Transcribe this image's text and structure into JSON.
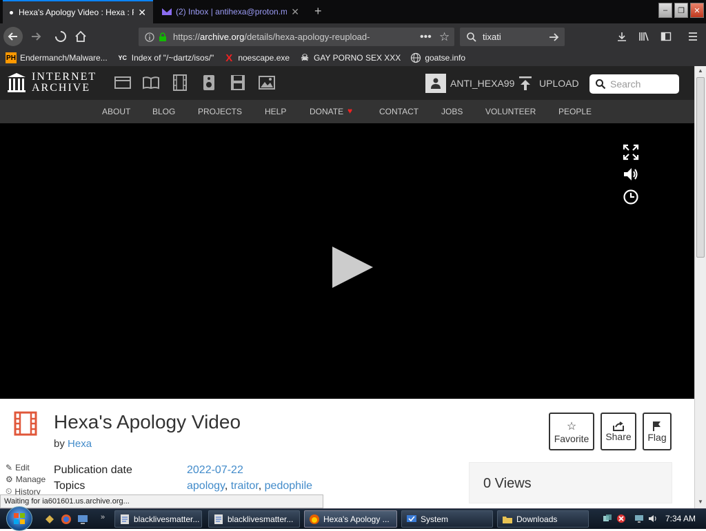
{
  "browser": {
    "tabs": [
      {
        "title": "Hexa's Apology Video : Hexa : F",
        "active": true
      },
      {
        "title": "(2) Inbox | antihexa@proton.m",
        "active": false
      }
    ],
    "url": {
      "scheme": "https://",
      "domain": "archive.org",
      "path": "/details/hexa-apology-reupload-"
    },
    "search_value": "tixati",
    "bookmarks": [
      {
        "label": "Endermanch/Malware...",
        "icon": "pornhub-icon"
      },
      {
        "label": "Index of \"/~dartz/isos/\"",
        "icon": "yc-icon"
      },
      {
        "label": "noescape.exe",
        "icon": "x-icon"
      },
      {
        "label": "GAY PORNO SEX XXX",
        "icon": "skull-icon"
      },
      {
        "label": "goatse.info",
        "icon": "globe-icon"
      }
    ],
    "status_text": "Waiting for ia601601.us.archive.org..."
  },
  "ia": {
    "logo": {
      "line1": "INTERNET",
      "line2": "ARCHIVE"
    },
    "user": "ANTI_HEXA99",
    "upload": "UPLOAD",
    "search_placeholder": "Search",
    "nav": [
      "ABOUT",
      "BLOG",
      "PROJECTS",
      "HELP",
      "DONATE",
      "CONTACT",
      "JOBS",
      "VOLUNTEER",
      "PEOPLE"
    ]
  },
  "item": {
    "title": "Hexa's Apology Video",
    "by_prefix": "by",
    "author": "Hexa",
    "actions": {
      "favorite": "Favorite",
      "share": "Share",
      "flag": "Flag"
    },
    "side_links": {
      "edit": "Edit",
      "manage": "Manage",
      "history": "History"
    },
    "meta": {
      "pub_label": "Publication date",
      "pub_value": "2022-07-22",
      "topics_label": "Topics",
      "topics": [
        "apology",
        "traitor",
        "pedophile"
      ]
    },
    "views": "0 Views"
  },
  "taskbar": {
    "items": [
      "blacklivesmatter...",
      "blacklivesmatter...",
      "Hexa's Apology ...",
      "System",
      "Downloads"
    ],
    "active_index": 2,
    "clock": "7:34 AM"
  },
  "colors": {
    "accent_link": "#428bca",
    "firefox_dark": "#323234",
    "ia_header": "#232323",
    "donate_heart": "#e22"
  }
}
